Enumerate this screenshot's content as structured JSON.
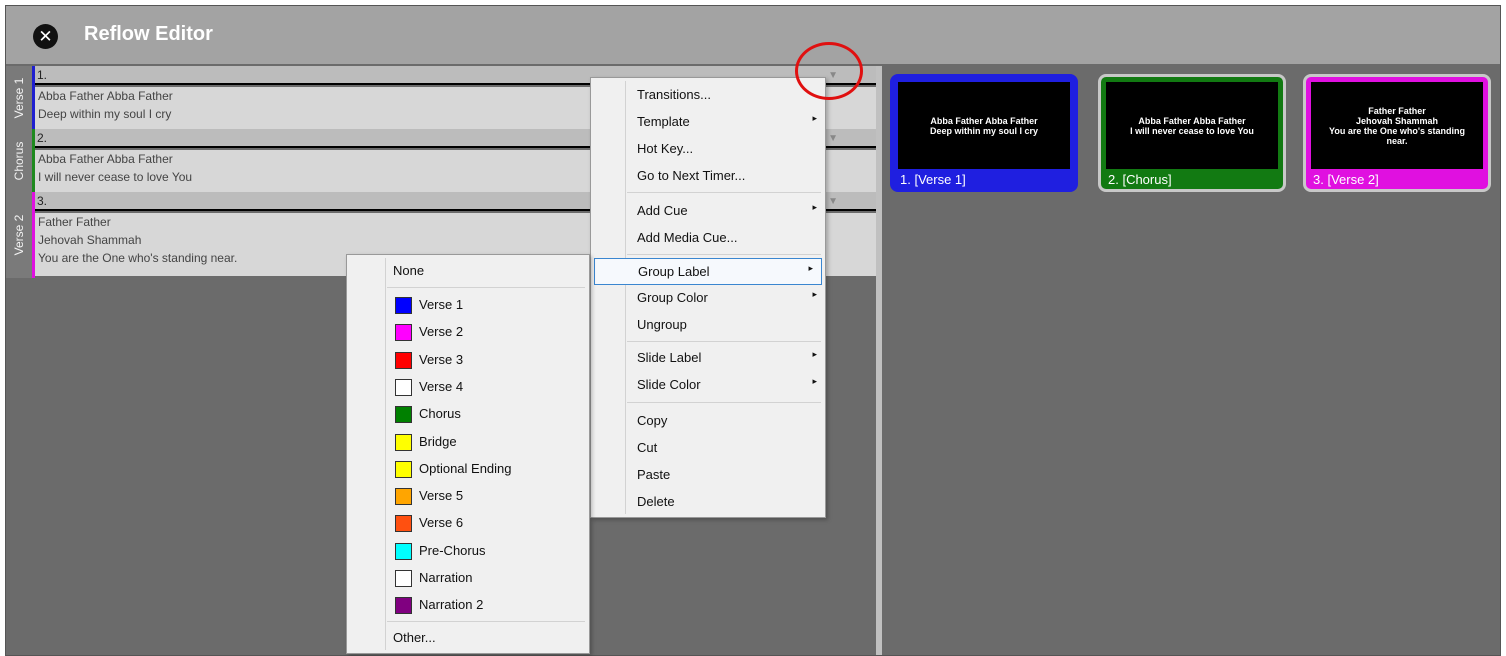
{
  "window": {
    "title": "Reflow Editor",
    "close_icon": "close-circle-icon"
  },
  "groups": [
    {
      "label": "Verse 1",
      "color": "#1f1fd0",
      "slide_number": "1.",
      "lines": [
        "Abba Father Abba Father",
        "Deep within my soul I cry"
      ]
    },
    {
      "label": "Chorus",
      "color": "#1e8a1e",
      "slide_number": "2.",
      "lines": [
        "Abba Father Abba Father",
        "I will never cease to love You"
      ]
    },
    {
      "label": "Verse 2",
      "color": "#e010e0",
      "slide_number": "3.",
      "lines": [
        "Father Father",
        "Jehovah Shammah",
        "You are the One who's standing near."
      ]
    }
  ],
  "dropdown_icon": "▼",
  "thumbnails": [
    {
      "label": "1.  [Verse 1]",
      "color": "#1f1fe0",
      "text": [
        "Abba Father Abba Father",
        "Deep within my soul I cry"
      ]
    },
    {
      "label": "2.  [Chorus]",
      "color": "#127a12",
      "text": [
        "Abba Father Abba Father",
        "I will never cease to love You"
      ]
    },
    {
      "label": "3.  [Verse 2]",
      "color": "#e010e0",
      "text": [
        "Father Father",
        "Jehovah Shammah",
        "You are the One who's standing",
        "near."
      ]
    }
  ],
  "context_menu": {
    "submenu_icon": "▸",
    "items": {
      "transitions": "Transitions...",
      "template": "Template",
      "hot_key": "Hot Key...",
      "next_timer": "Go to Next Timer...",
      "add_cue": "Add Cue",
      "add_media_cue": "Add Media Cue...",
      "group_label": "Group Label",
      "group_color": "Group Color",
      "ungroup": "Ungroup",
      "slide_label": "Slide Label",
      "slide_color": "Slide Color",
      "copy": "Copy",
      "cut": "Cut",
      "paste": "Paste",
      "delete": "Delete"
    }
  },
  "group_label_menu": {
    "none": "None",
    "other": "Other...",
    "labels": [
      {
        "name": "Verse 1",
        "color": "#0000ff"
      },
      {
        "name": "Verse 2",
        "color": "#ff00ff"
      },
      {
        "name": "Verse 3",
        "color": "#ff0000"
      },
      {
        "name": "Verse 4",
        "color": "#ffffff"
      },
      {
        "name": "Chorus",
        "color": "#008000"
      },
      {
        "name": "Bridge",
        "color": "#ffff00"
      },
      {
        "name": "Optional Ending",
        "color": "#ffff00"
      },
      {
        "name": "Verse 5",
        "color": "#ffa500"
      },
      {
        "name": "Verse 6",
        "color": "#ff5010"
      },
      {
        "name": "Pre-Chorus",
        "color": "#00ffff"
      },
      {
        "name": "Narration",
        "color": "#ffffff"
      },
      {
        "name": "Narration 2",
        "color": "#800080"
      }
    ]
  }
}
